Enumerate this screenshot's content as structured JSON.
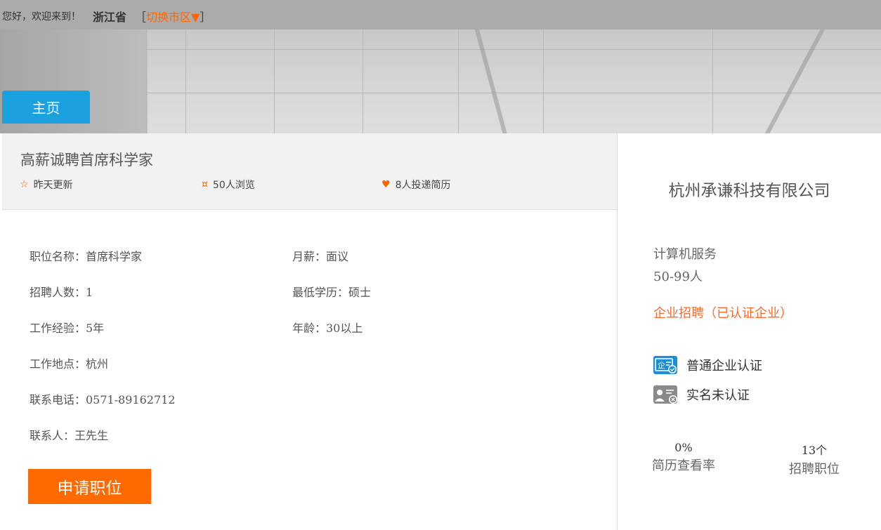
{
  "topbar": {
    "greeting": "您好，欢迎来到！",
    "province": "浙江省",
    "bracket_open": "［",
    "switch_label": "切换市区▼",
    "bracket_close": "］"
  },
  "nav": {
    "home_label": "主页"
  },
  "job": {
    "title": "高薪诚聘首席科学家",
    "updated": "昨天更新",
    "views": "50人浏览",
    "applied": "8人投递简历",
    "fields": {
      "position": "职位名称：首席科学家",
      "salary": "月薪：面议",
      "headcount": "招聘人数：1",
      "education": "最低学历：硕士",
      "experience": "工作经验：5年",
      "age": "年龄：30以上",
      "location": "工作地点：杭州",
      "phone": "联系电话：0571-89162712",
      "contact": "联系人：王先生"
    },
    "apply_label": "申请职位"
  },
  "company": {
    "name": "杭州承谦科技有限公司",
    "industry": "计算机服务",
    "size": "50-99人",
    "status": "企业招聘（已认证企业）",
    "cert_business": "普通企业认证",
    "cert_realname": "实名未认证",
    "stats": {
      "resume_rate": "0%",
      "resume_rate_label": "简历查看率",
      "positions": "13个",
      "positions_label": "招聘职位"
    }
  },
  "colors": {
    "accent": "#ff6600",
    "tab": "#1ba0e0",
    "cert_blue": "#1a8fd8"
  }
}
